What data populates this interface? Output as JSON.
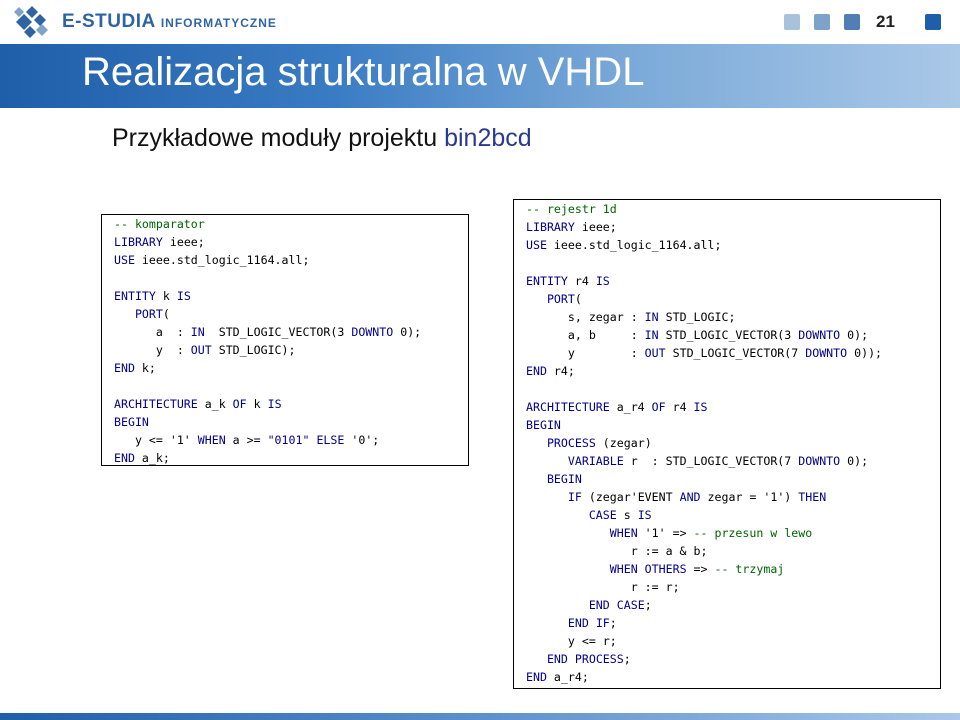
{
  "header": {
    "brand_main": "E-STUDIA",
    "brand_sub": "INFORMATYCZNE",
    "page_number": "21",
    "squares": [
      "#a9c2dc",
      "#7ea3c9",
      "#4f7fb3",
      "#1f5ea8"
    ]
  },
  "slide": {
    "title": "Realizacja strukturalna w VHDL",
    "subtitle_prefix": "Przykładowe moduły projektu ",
    "subtitle_highlight": "bin2bcd"
  },
  "code_left": {
    "label": "komparator",
    "lines": [
      "-- komparator",
      "LIBRARY ieee;",
      "USE ieee.std_logic_1164.all;",
      "",
      "ENTITY k IS",
      "   PORT(",
      "      a  : IN  STD_LOGIC_VECTOR(3 DOWNTO 0);",
      "      y  : OUT STD_LOGIC);",
      "END k;",
      "",
      "ARCHITECTURE a_k OF k IS",
      "BEGIN",
      "   y <= '1' WHEN a >= \"0101\" ELSE '0';",
      "END a_k;"
    ]
  },
  "code_right": {
    "label": "rejestr 1d",
    "lines": [
      "-- rejestr 1d",
      "LIBRARY ieee;",
      "USE ieee.std_logic_1164.all;",
      "",
      "ENTITY r4 IS",
      "   PORT(",
      "      s, zegar : IN STD_LOGIC;",
      "      a, b     : IN STD_LOGIC_VECTOR(3 DOWNTO 0);",
      "      y        : OUT STD_LOGIC_VECTOR(7 DOWNTO 0));",
      "END r4;",
      "",
      "ARCHITECTURE a_r4 OF r4 IS",
      "BEGIN",
      "   PROCESS (zegar)",
      "      VARIABLE r  : STD_LOGIC_VECTOR(7 DOWNTO 0);",
      "   BEGIN",
      "      IF (zegar'EVENT AND zegar = '1') THEN",
      "         CASE s IS",
      "            WHEN '1' => -- przesun w lewo",
      "               r := a & b;",
      "            WHEN OTHERS => -- trzymaj",
      "               r := r;",
      "         END CASE;",
      "      END IF;",
      "      y <= r;",
      "   END PROCESS;",
      "END a_r4;"
    ]
  }
}
